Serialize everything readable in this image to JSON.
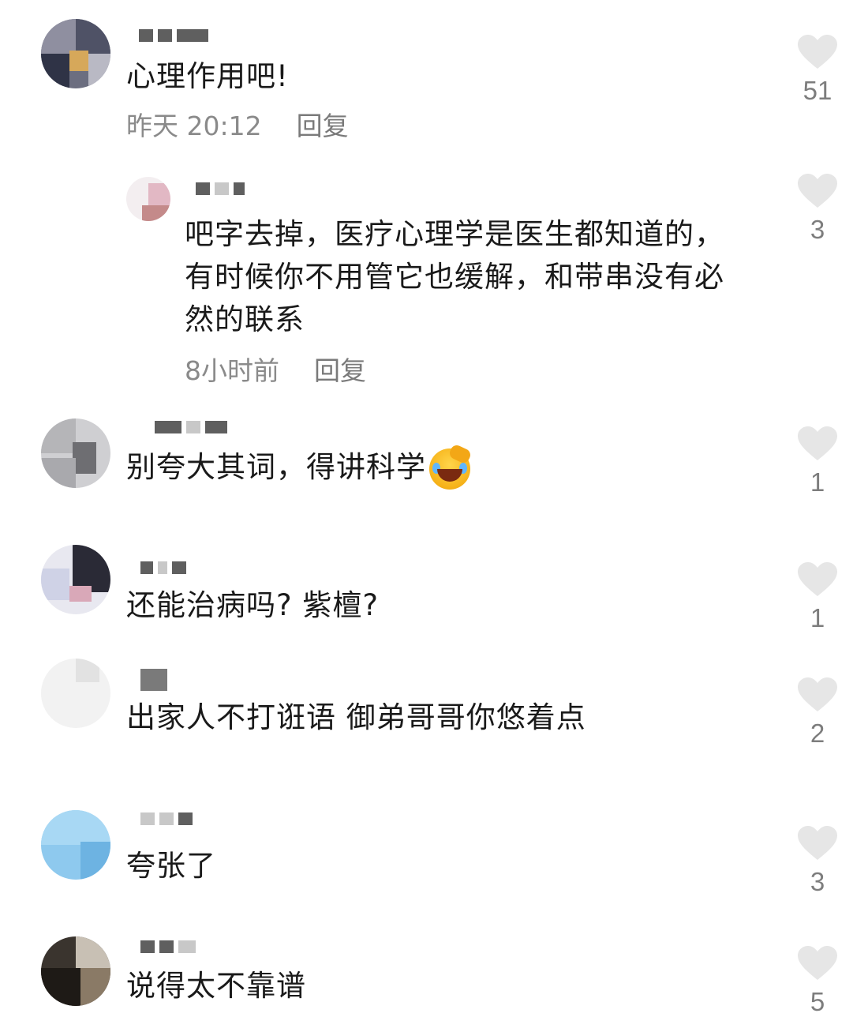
{
  "comments": [
    {
      "text": "心理作用吧!",
      "time": "昨天 20:12",
      "reply_label": "回复",
      "likes": "51"
    },
    {
      "text_lines": [
        "吧字去掉，医疗心理学是医生都知道的，",
        "有时候你不用管它也缓解，和带串没有必",
        "然的联系"
      ],
      "time": "8小时前",
      "reply_label": "回复",
      "likes": "3"
    },
    {
      "text": "别夸大其词，得讲科学",
      "emoji": "laughing-crying-emoji",
      "likes": "1"
    },
    {
      "text": "还能治病吗? 紫檀?",
      "likes": "1"
    },
    {
      "text": "出家人不打诳语 御弟哥哥你悠着点",
      "likes": "2"
    },
    {
      "text": "夸张了",
      "likes": "3"
    },
    {
      "text": "说得太不靠谱",
      "likes": "5"
    }
  ],
  "colors": {
    "heart": "#e6e6e6",
    "text": "#1a1a1a",
    "meta": "#8a8a8a"
  }
}
